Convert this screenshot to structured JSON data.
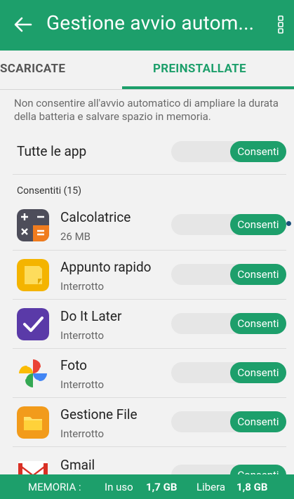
{
  "header": {
    "title": "Gestione avvio autom..."
  },
  "tabs": [
    {
      "label": "SCARICATE"
    },
    {
      "label": "PREINSTALLATE"
    }
  ],
  "description": "Non consentire all'avvio automatico di ampliare la durata della batteria e salvare spazio in memoria.",
  "all_apps": {
    "label": "Tutte le app",
    "toggle": "Consenti"
  },
  "section_label": "Consentiti (15)",
  "apps": [
    {
      "name": "Calcolatrice",
      "sub": "26 MB",
      "toggle": "Consenti"
    },
    {
      "name": "Appunto rapido",
      "sub": "Interrotto",
      "toggle": "Consenti"
    },
    {
      "name": "Do It Later",
      "sub": "Interrotto",
      "toggle": "Consenti"
    },
    {
      "name": "Foto",
      "sub": "Interrotto",
      "toggle": "Consenti"
    },
    {
      "name": "Gestione File",
      "sub": "Interrotto",
      "toggle": "Consenti"
    },
    {
      "name": "Gmail",
      "sub": "",
      "toggle": "Consenti"
    }
  ],
  "footer": {
    "memory_label": "MEMORIA :",
    "in_use_label": "In uso",
    "in_use_value": "1,7 GB",
    "free_label": "Libera",
    "free_value": "1,8 GB"
  },
  "colors": {
    "accent": "#1d9f6b"
  },
  "icons": [
    "back-arrow-icon",
    "more-vert-icon",
    "calculator-icon",
    "quick-memo-icon",
    "do-it-later-icon",
    "photos-icon",
    "file-manager-icon",
    "gmail-icon"
  ]
}
